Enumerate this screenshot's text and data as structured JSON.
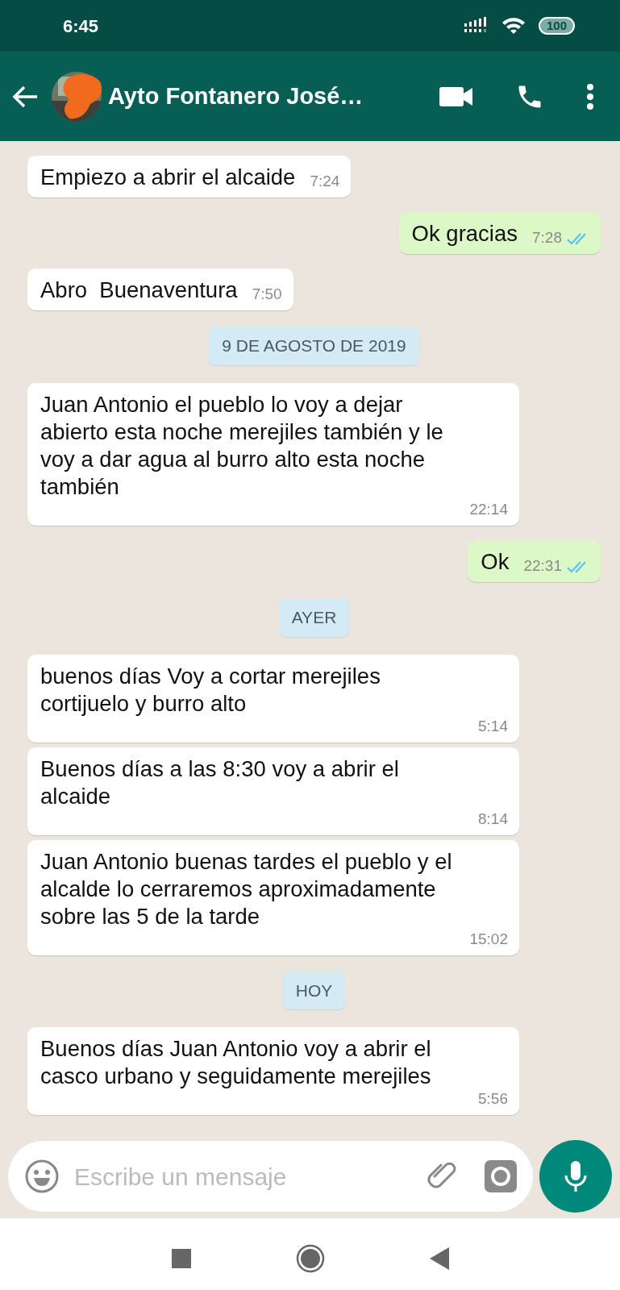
{
  "status_bar": {
    "time": "6:45",
    "battery": "100"
  },
  "header": {
    "title": "Ayto Fontanero José…"
  },
  "messages": [
    {
      "kind": "in",
      "text": "Empiezo a abrir el alcaide",
      "time": "7:24"
    },
    {
      "kind": "out",
      "text": "Ok gracias",
      "time": "7:28",
      "read": true
    },
    {
      "kind": "in",
      "text": "Abro  Buenaventura",
      "time": "7:50"
    },
    {
      "kind": "date",
      "text": "9 DE AGOSTO DE 2019"
    },
    {
      "kind": "in",
      "text": "Juan Antonio el pueblo lo voy a dejar abierto esta noche merejiles también y le voy a dar agua al burro alto esta noche también",
      "time": "22:14"
    },
    {
      "kind": "out",
      "text": "Ok",
      "time": "22:31",
      "read": true
    },
    {
      "kind": "date",
      "text": "AYER"
    },
    {
      "kind": "in",
      "text": "buenos días Voy a cortar merejiles cortijuelo y burro alto",
      "time": "5:14"
    },
    {
      "kind": "in",
      "text": "Buenos días a las 8:30 voy a abrir el alcaide",
      "time": "8:14"
    },
    {
      "kind": "in",
      "text": "Juan Antonio buenas tardes el pueblo y el alcalde lo cerraremos aproximadamente sobre las 5 de la tarde",
      "time": "15:02"
    },
    {
      "kind": "date",
      "text": "HOY"
    },
    {
      "kind": "in",
      "text": "Buenos días Juan Antonio voy a abrir el casco urbano y seguidamente merejiles",
      "time": "5:56"
    }
  ],
  "composer": {
    "placeholder": "Escribe un mensaje"
  }
}
